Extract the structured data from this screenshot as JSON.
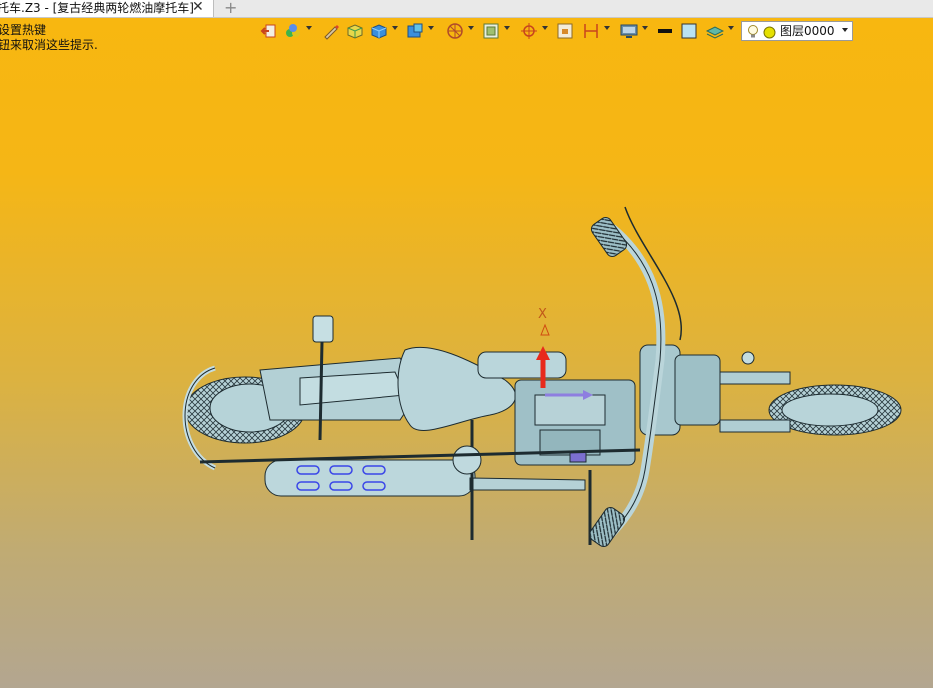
{
  "tab": {
    "title": "托车.Z3 - [复古经典两轮燃油摩托车]",
    "close": "✕",
    "new_tab": "+"
  },
  "hints": {
    "line1": "设置热键",
    "line2": "钮来取消这些提示."
  },
  "toolbar": {
    "icons": [
      "exit-icon",
      "color-palette-icon",
      "pen-icon",
      "box-yellow-icon",
      "box-blue-icon",
      "solid-icon",
      "wheel-icon",
      "view-frame-icon",
      "snap-icon",
      "grid-icon",
      "dimension-icon",
      "monitor-icon",
      "line-style-icon",
      "fill-color-icon",
      "layer-stack-icon"
    ],
    "layer": {
      "value": "图层0000",
      "bulb_icon": "bulb-icon",
      "dot_color": "#e5e000"
    }
  },
  "axis": {
    "label": "X",
    "color": "#e82a1c"
  },
  "colors": {
    "background_top": "#f8b70f",
    "background_bottom": "#b3a690",
    "model": "#a9c9cf",
    "model_line": "#1d2b30",
    "accent": "#3a46e8"
  }
}
